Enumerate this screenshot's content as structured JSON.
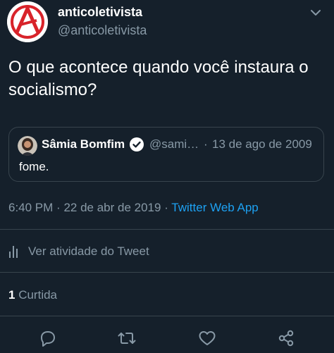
{
  "tweet": {
    "author_name": "anticoletivista",
    "author_handle": "@anticoletivista",
    "text": "O que acontece quando você instaura o socialismo?",
    "quoted": {
      "name": "Sâmia Bomfim",
      "handle": "@sami…",
      "separator": "·",
      "date": "13 de ago de 2009",
      "text": "fome."
    },
    "time": "6:40 PM",
    "date": "22 de abr de 2019",
    "separator": "·",
    "source": "Twitter Web App",
    "activity_label": "Ver atividade do Tweet",
    "likes_count": "1",
    "likes_label": "Curtida"
  },
  "icons": {
    "more": "chevron-down-icon",
    "verified": "verified-badge-icon",
    "activity": "bar-chart-icon",
    "reply": "reply-icon",
    "retweet": "retweet-icon",
    "like": "heart-icon",
    "share": "share-icon"
  },
  "colors": {
    "background": "#15202b",
    "text": "#ffffff",
    "secondary_text": "#8899a6",
    "link": "#1da1f2",
    "border": "#38444d",
    "avatar_accent": "#d8232a"
  }
}
